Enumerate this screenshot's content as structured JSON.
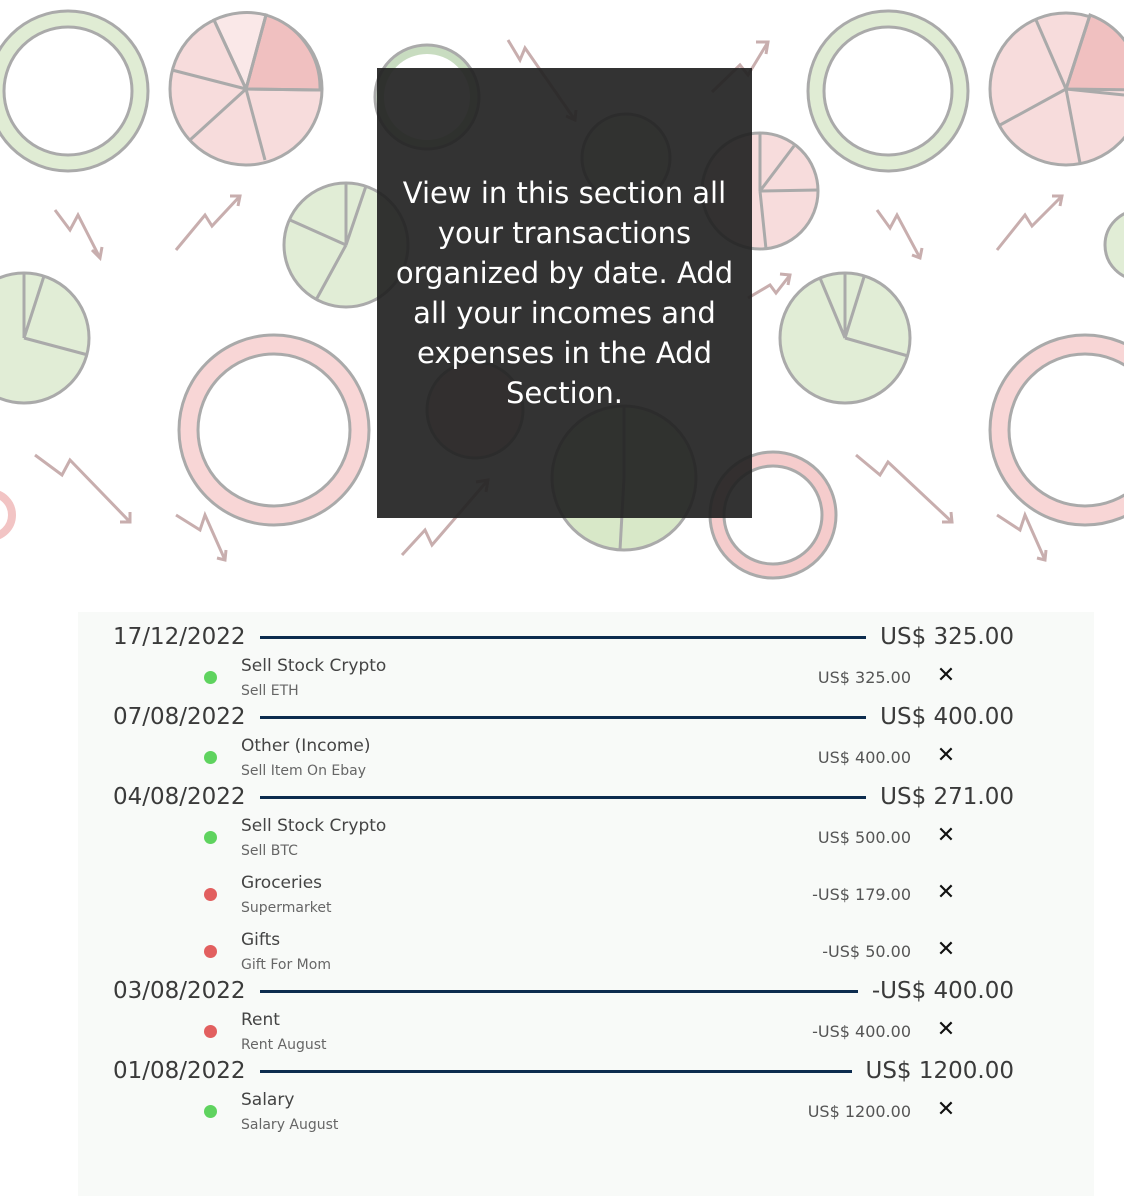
{
  "hero": {
    "message": "View in this section all your transactions organized by date. Add all your incomes and expenses in the Add Section."
  },
  "colors": {
    "income": "#5fd35f",
    "expense": "#e25f5f",
    "divider": "#0d2c4f",
    "overlay": "#222222"
  },
  "transactions": {
    "groups": [
      {
        "date": "17/12/2022",
        "total": "US$ 325.00",
        "items": [
          {
            "category": "Sell Stock Crypto",
            "description": "Sell ETH",
            "amount": "US$ 325.00",
            "type": "income",
            "delete_icon": "close-icon"
          }
        ]
      },
      {
        "date": "07/08/2022",
        "total": "US$ 400.00",
        "items": [
          {
            "category": "Other (Income)",
            "description": "Sell Item On Ebay",
            "amount": "US$ 400.00",
            "type": "income",
            "delete_icon": "close-icon"
          }
        ]
      },
      {
        "date": "04/08/2022",
        "total": "US$ 271.00",
        "items": [
          {
            "category": "Sell Stock Crypto",
            "description": "Sell BTC",
            "amount": "US$ 500.00",
            "type": "income",
            "delete_icon": "close-icon"
          },
          {
            "category": "Groceries",
            "description": "Supermarket",
            "amount": "-US$ 179.00",
            "type": "expense",
            "delete_icon": "close-icon"
          },
          {
            "category": "Gifts",
            "description": "Gift For Mom",
            "amount": "-US$ 50.00",
            "type": "expense",
            "delete_icon": "close-icon"
          }
        ]
      },
      {
        "date": "03/08/2022",
        "total": "-US$ 400.00",
        "items": [
          {
            "category": "Rent",
            "description": "Rent August",
            "amount": "-US$ 400.00",
            "type": "expense",
            "delete_icon": "close-icon"
          }
        ]
      },
      {
        "date": "01/08/2022",
        "total": "US$ 1200.00",
        "items": [
          {
            "category": "Salary",
            "description": "Salary August",
            "amount": "US$ 1200.00",
            "type": "income",
            "delete_icon": "close-icon"
          }
        ]
      }
    ]
  }
}
